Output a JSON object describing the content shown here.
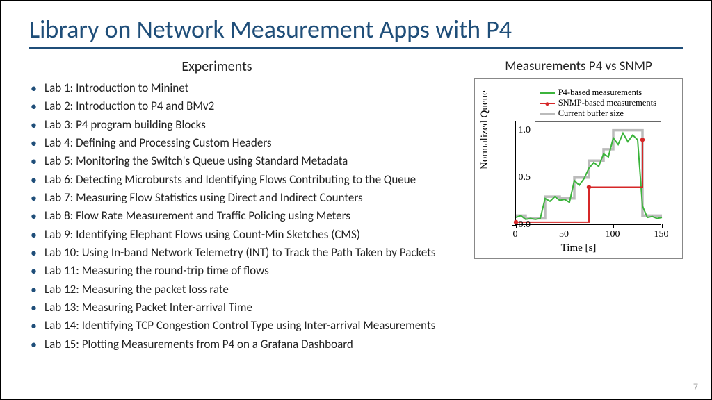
{
  "title": "Library on Network Measurement Apps with P4",
  "experiments_heading": "Experiments",
  "labs": [
    "Lab 1: Introduction to Mininet",
    "Lab 2: Introduction to P4 and BMv2",
    "Lab 3: P4 program building Blocks",
    "Lab 4: Defining and Processing Custom Headers",
    "Lab 5: Monitoring the Switch's Queue using Standard Metadata",
    "Lab 6: Detecting Microbursts and Identifying Flows Contributing to the Queue",
    "Lab 7: Measuring Flow Statistics using Direct and Indirect Counters",
    "Lab 8: Flow Rate Measurement and Traffic Policing using Meters",
    "Lab 9: Identifying Elephant Flows using Count-Min Sketches (CMS)",
    "Lab 10: Using In-band Network Telemetry (INT) to Track the Path Taken by Packets",
    "Lab 11: Measuring the round-trip time of flows",
    "Lab 12: Measuring the packet loss rate",
    "Lab 13: Measuring Packet Inter-arrival Time",
    "Lab 14: Identifying TCP Congestion Control Type using Inter-arrival Measurements",
    "Lab 15: Plotting Measurements from P4 on a Grafana Dashboard"
  ],
  "chart_title": "Measurements P4 vs SNMP",
  "page_number": "7",
  "chart_data": {
    "type": "line",
    "title": "Measurements P4 vs SNMP",
    "xlabel": "Time [s]",
    "ylabel": "Normalized Queue",
    "xlim": [
      0,
      150
    ],
    "ylim": [
      0,
      1.1
    ],
    "xticks": [
      0,
      50,
      100,
      150
    ],
    "yticks": [
      0.0,
      0.5,
      1.0
    ],
    "legend": [
      "P4-based measurements",
      "SNMP-based measurements",
      "Current buffer size"
    ],
    "legend_position": "upper right (inset)",
    "series": [
      {
        "name": "Current buffer size",
        "color": "#bbbbbb",
        "style": "step",
        "x": [
          0,
          10,
          10,
          30,
          30,
          45,
          45,
          60,
          60,
          75,
          75,
          90,
          90,
          100,
          100,
          130,
          130,
          150
        ],
        "y": [
          0.1,
          0.1,
          0.07,
          0.07,
          0.3,
          0.3,
          0.28,
          0.28,
          0.5,
          0.5,
          0.68,
          0.68,
          0.8,
          0.8,
          1.0,
          1.0,
          0.1,
          0.1
        ]
      },
      {
        "name": "P4-based measurements",
        "color": "#3cb43c",
        "style": "jitter-line",
        "x": [
          0,
          5,
          10,
          15,
          20,
          25,
          30,
          35,
          40,
          45,
          50,
          55,
          60,
          65,
          70,
          75,
          80,
          85,
          90,
          95,
          100,
          105,
          110,
          115,
          120,
          125,
          130,
          135,
          140,
          145,
          150
        ],
        "y": [
          0.08,
          0.1,
          0.06,
          0.07,
          0.06,
          0.07,
          0.28,
          0.25,
          0.3,
          0.26,
          0.27,
          0.24,
          0.47,
          0.42,
          0.49,
          0.6,
          0.66,
          0.62,
          0.75,
          0.72,
          0.92,
          0.85,
          0.97,
          0.88,
          0.95,
          0.9,
          0.2,
          0.08,
          0.09,
          0.07,
          0.08
        ]
      },
      {
        "name": "SNMP-based measurements",
        "color": "#d62728",
        "style": "step-markers",
        "x": [
          0,
          75,
          75,
          130,
          130
        ],
        "y": [
          0.03,
          0.03,
          0.4,
          0.4,
          0.9
        ],
        "markers": [
          {
            "x": 0,
            "y": 0.03
          },
          {
            "x": 75,
            "y": 0.4
          },
          {
            "x": 130,
            "y": 0.9
          }
        ]
      }
    ]
  }
}
